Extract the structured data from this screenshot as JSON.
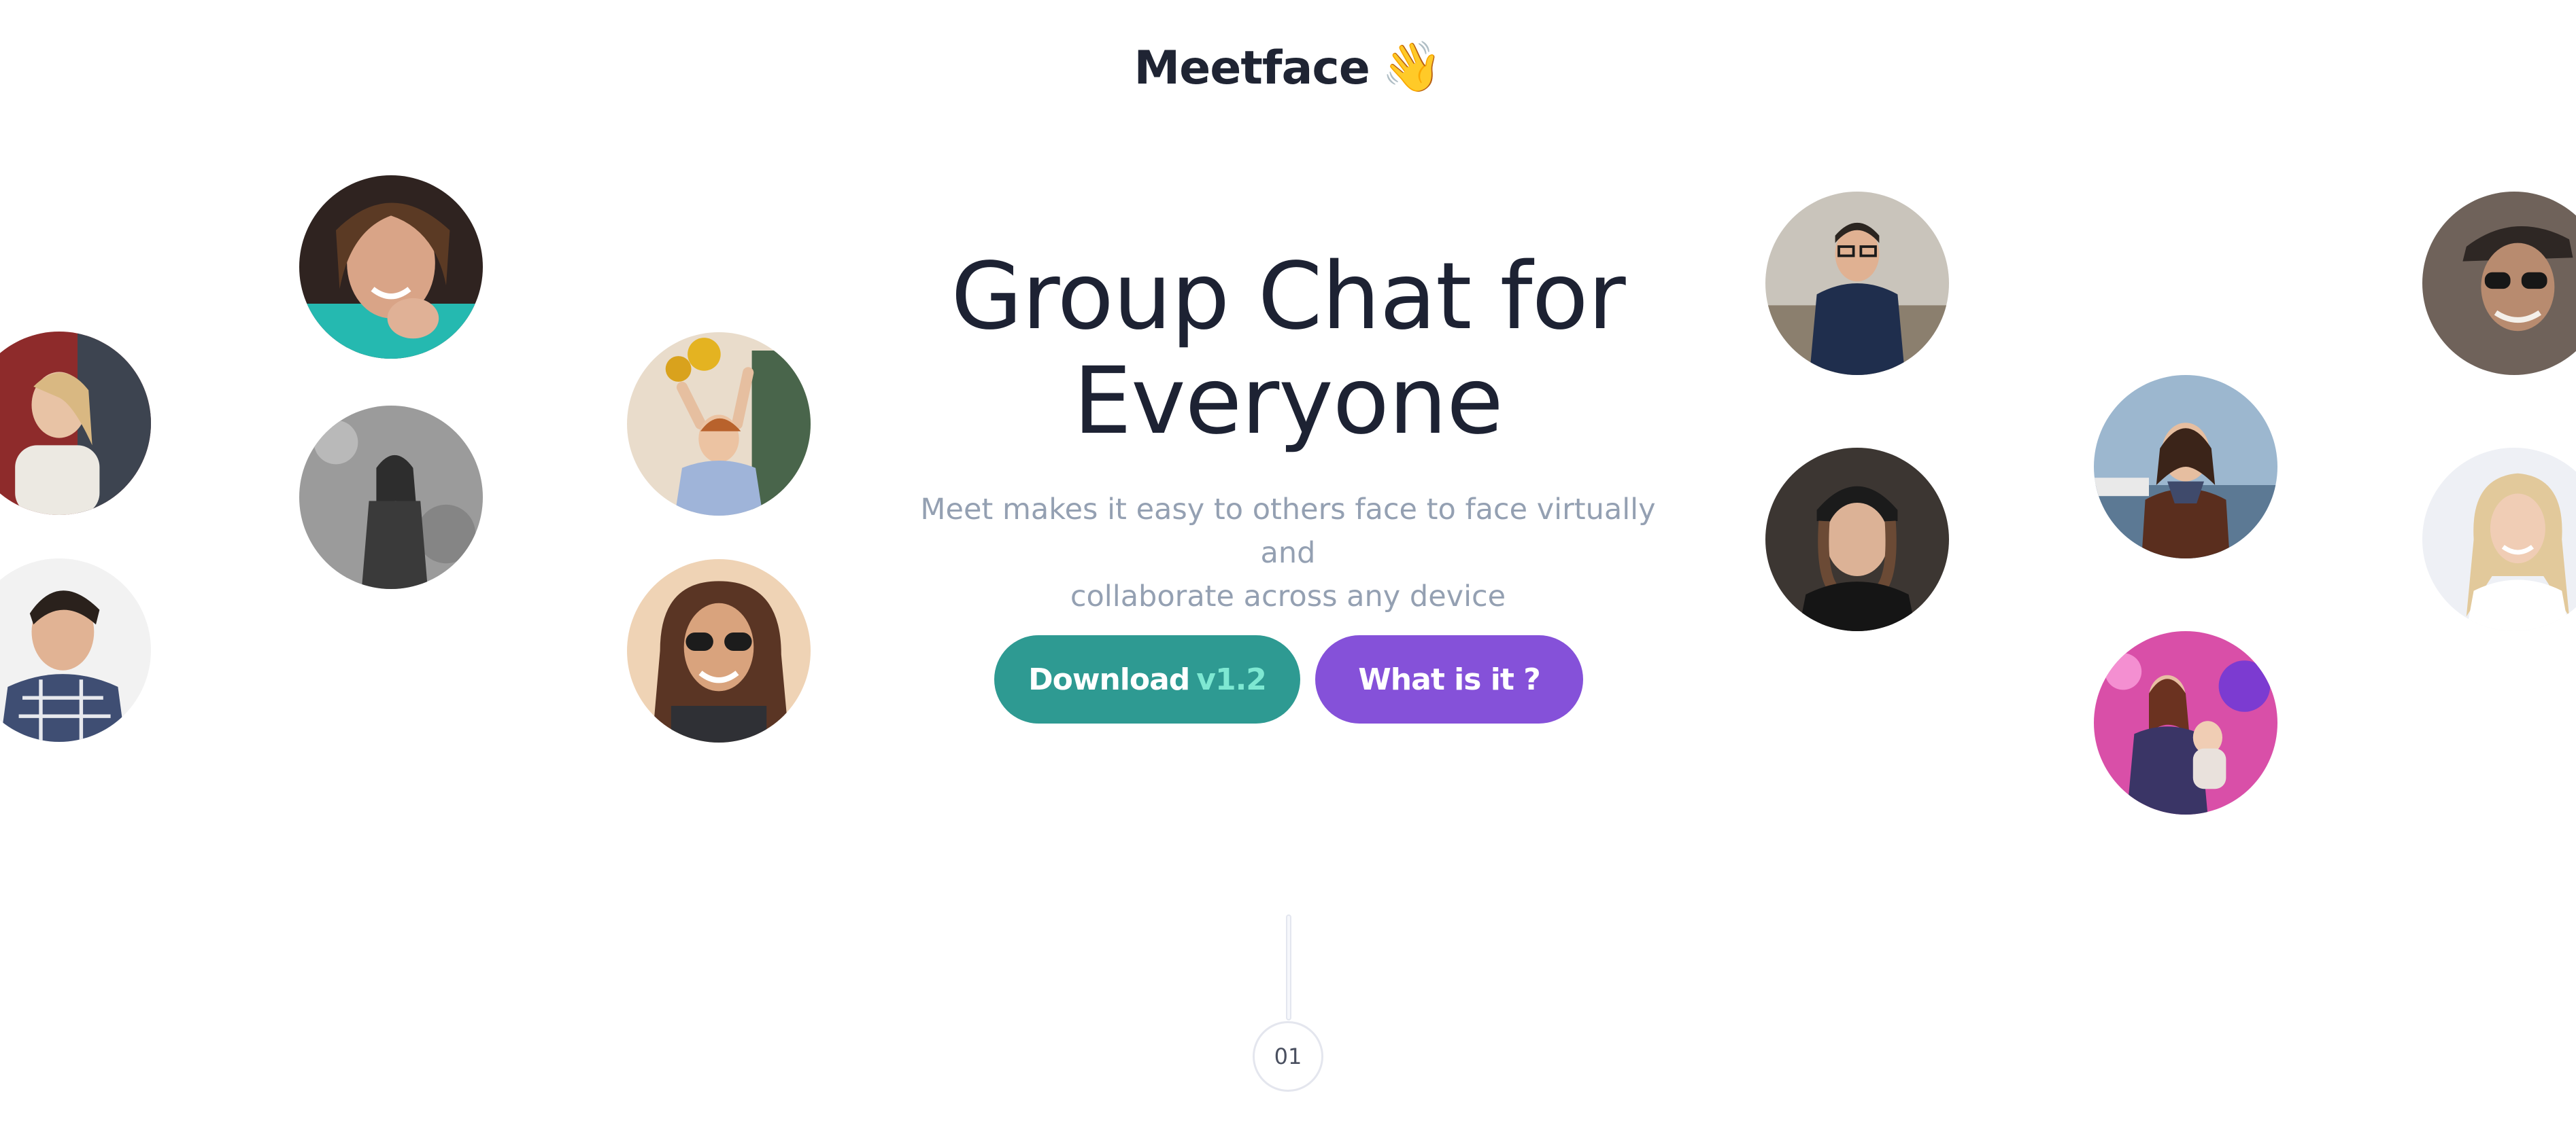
{
  "brand": {
    "name": "Meetface",
    "emoji": "👋"
  },
  "hero": {
    "title_line1": "Group Chat for",
    "title_line2": "Everyone",
    "subtitle_line1": "Meet makes it easy to others face to face virtually and",
    "subtitle_line2": "collaborate across any device"
  },
  "buttons": {
    "download_label": "Download",
    "download_version": "v1.2",
    "what_label": "What is it ?"
  },
  "colors": {
    "primary": "#2e9a92",
    "accent": "#8551d9",
    "version": "#7ee8d2",
    "text_dark": "#1d2233",
    "text_muted": "#94a0b2"
  },
  "avatars": [
    {
      "name": "woman-smiling-hand-on-chin"
    },
    {
      "name": "woman-laughing-red-wall"
    },
    {
      "name": "woman-black-and-white"
    },
    {
      "name": "man-plaid-shirt"
    },
    {
      "name": "woman-holding-sunflowers"
    },
    {
      "name": "woman-sunglasses-curly-hair"
    },
    {
      "name": "man-glasses-jacket"
    },
    {
      "name": "woman-black-beanie"
    },
    {
      "name": "woman-harbor-scarf"
    },
    {
      "name": "woman-carrying-child-neon"
    },
    {
      "name": "man-flat-cap-sunglasses"
    },
    {
      "name": "woman-blonde-white-top"
    }
  ],
  "step": {
    "number": "01"
  }
}
